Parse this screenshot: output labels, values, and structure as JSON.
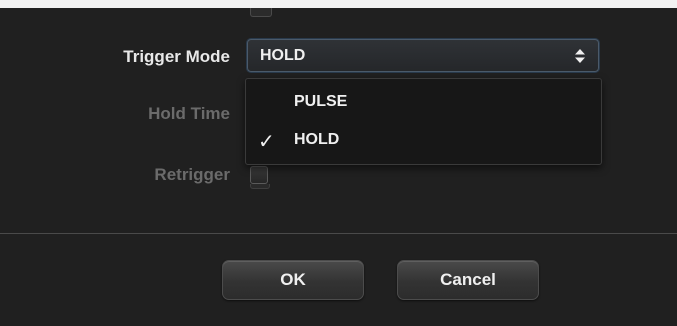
{
  "form": {
    "trigger_mode_label": "Trigger Mode",
    "hold_time_label": "Hold Time",
    "retrigger_label": "Retrigger",
    "retrigger_checked": false
  },
  "trigger_select": {
    "value": "HOLD",
    "options": [
      {
        "label": "PULSE",
        "selected": false
      },
      {
        "label": "HOLD",
        "selected": true
      }
    ],
    "check_symbol": "✓"
  },
  "buttons": {
    "ok_label": "OK",
    "cancel_label": "Cancel"
  },
  "colors": {
    "background": "#202020",
    "label_active": "#e8e8e8",
    "label_disabled": "#6b6b6b",
    "focus_ring": "#4b5a6a"
  }
}
